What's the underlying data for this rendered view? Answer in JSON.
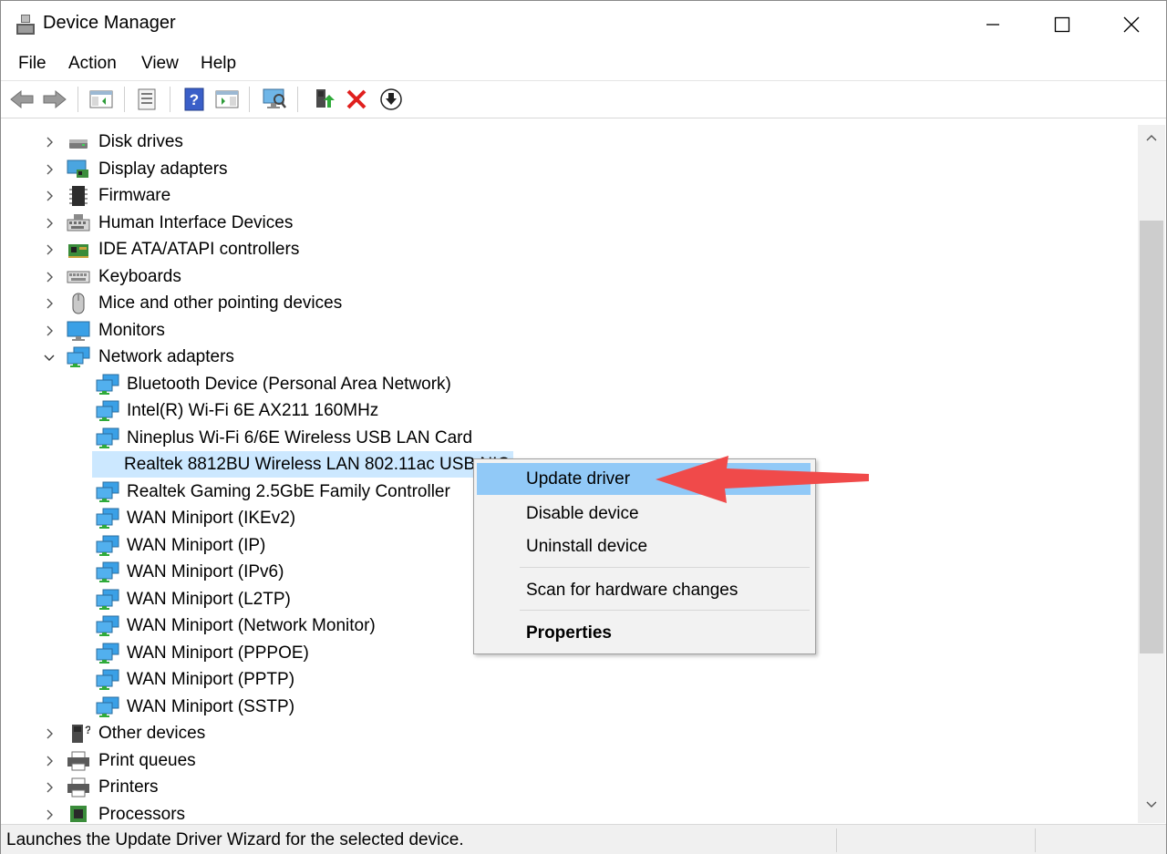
{
  "window": {
    "title": "Device Manager"
  },
  "menu": [
    "File",
    "Action",
    "View",
    "Help"
  ],
  "toolbar": {
    "icons": [
      "back-arrow-icon",
      "forward-arrow-icon",
      "show-hide-console-tree-icon",
      "properties-icon",
      "help-icon",
      "action-pane-icon",
      "scan-hardware-icon",
      "update-driver-icon",
      "uninstall-device-icon",
      "disable-device-icon"
    ]
  },
  "tree": {
    "categories": [
      {
        "label": "Disk drives",
        "icon": "disk-drive-icon",
        "expanded": false
      },
      {
        "label": "Display adapters",
        "icon": "display-adapter-icon",
        "expanded": false
      },
      {
        "label": "Firmware",
        "icon": "firmware-chip-icon",
        "expanded": false
      },
      {
        "label": "Human Interface Devices",
        "icon": "hid-keyboard-icon",
        "expanded": false
      },
      {
        "label": "IDE ATA/ATAPI controllers",
        "icon": "ide-controller-icon",
        "expanded": false
      },
      {
        "label": "Keyboards",
        "icon": "keyboard-icon",
        "expanded": false
      },
      {
        "label": "Mice and other pointing devices",
        "icon": "mouse-icon",
        "expanded": false
      },
      {
        "label": "Monitors",
        "icon": "monitor-icon",
        "expanded": false
      },
      {
        "label": "Network adapters",
        "icon": "network-adapter-icon",
        "expanded": true
      },
      {
        "label": "Other devices",
        "icon": "unknown-device-icon",
        "expanded": false
      },
      {
        "label": "Print queues",
        "icon": "printer-icon",
        "expanded": false
      },
      {
        "label": "Printers",
        "icon": "printer-icon",
        "expanded": false
      },
      {
        "label": "Processors",
        "icon": "processor-icon",
        "expanded": false
      }
    ],
    "network_adapters": [
      "Bluetooth Device (Personal Area Network)",
      "Intel(R) Wi-Fi 6E AX211 160MHz",
      "Nineplus Wi-Fi 6/6E Wireless USB LAN Card",
      "Realtek 8812BU Wireless LAN 802.11ac USB NIC",
      "Realtek Gaming 2.5GbE Family Controller",
      "WAN Miniport (IKEv2)",
      "WAN Miniport (IP)",
      "WAN Miniport (IPv6)",
      "WAN Miniport (L2TP)",
      "WAN Miniport (Network Monitor)",
      "WAN Miniport (PPPOE)",
      "WAN Miniport (PPTP)",
      "WAN Miniport (SSTP)"
    ],
    "selected_index": 3
  },
  "context_menu": {
    "items": [
      "Update driver",
      "Disable device",
      "Uninstall device",
      "Scan for hardware changes",
      "Properties"
    ],
    "highlighted": "Update driver"
  },
  "status": {
    "text": "Launches the Update Driver Wizard for the selected device."
  },
  "colors": {
    "selection": "#cce8ff",
    "menu_highlight": "#91c9f7",
    "annotation_arrow": "#f04a4a"
  }
}
